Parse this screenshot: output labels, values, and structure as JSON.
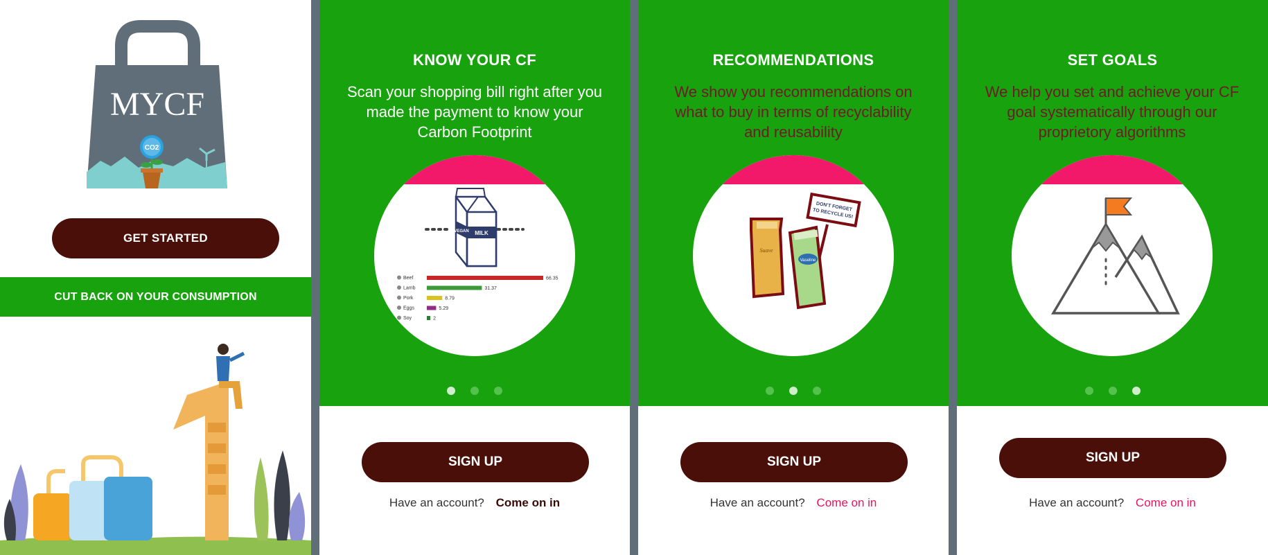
{
  "screen1": {
    "logo_text": "MYCF",
    "co2_text": "CO2",
    "get_started_label": "GET STARTED",
    "tagline": "CUT BACK ON YOUR CONSUMPTION"
  },
  "screen2": {
    "title": "KNOW YOUR CF",
    "description": "Scan your shopping bill right after you made the payment to know your Carbon Footprint",
    "milk_label_vegan": "VEGAN",
    "milk_label_milk": "MILK",
    "chart_data": {
      "type": "bar",
      "categories": [
        "Beef",
        "Lamb",
        "Pork",
        "Eggs",
        "Soy"
      ],
      "values": [
        66.35,
        31.37,
        8.79,
        5.29,
        2
      ],
      "colors": [
        "#c62828",
        "#3d9a3a",
        "#d8c320",
        "#8e2c86",
        "#2e7d32"
      ]
    },
    "signup_label": "SIGN UP",
    "account_question": "Have an account?",
    "come_in_label": "Come on in",
    "dots_active": 1
  },
  "screen3": {
    "title": "RECOMMENDATIONS",
    "description": "We show you recommendations on what to buy in terms of recyclability and reusability",
    "sign_text": "DON'T FORGET TO RECYCLE US!",
    "bottle1_brand": "Suave",
    "bottle2_brand": "Vaseline",
    "signup_label": "SIGN UP",
    "account_question": "Have an account?",
    "come_in_label": "Come on in",
    "dots_active": 2
  },
  "screen4": {
    "title": "SET GOALS",
    "description": "We help you set and achieve your CF goal systematically through our proprietory algorithms",
    "signup_label": "SIGN UP",
    "account_question": "Have an account?",
    "come_in_label": "Come on in",
    "dots_active": 3
  },
  "colors": {
    "green": "#17a20e",
    "maroon": "#4a0f08",
    "pink": "#f2186a",
    "bag": "#5f6e78"
  }
}
